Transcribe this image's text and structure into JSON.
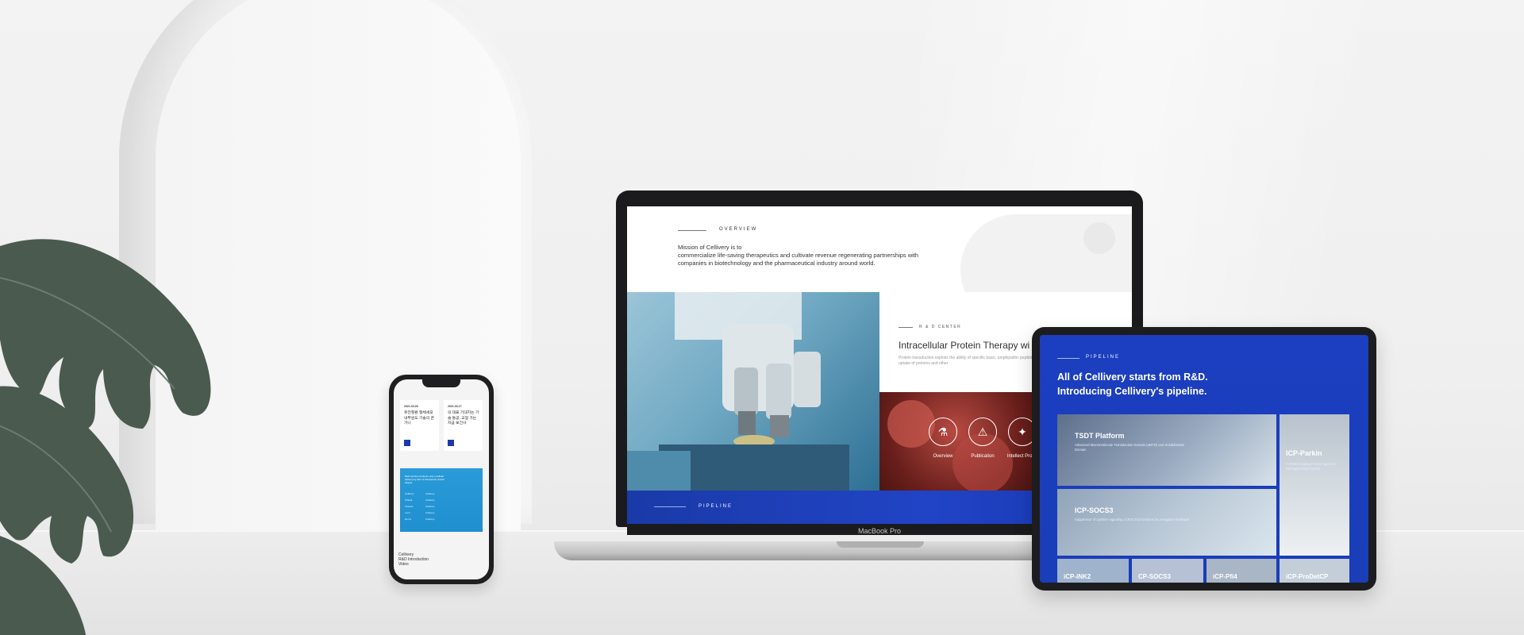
{
  "laptop": {
    "brand": "MacBook Pro",
    "overview": {
      "label": "OVERVIEW",
      "mission_line1": "Mission of Cellivery is to",
      "mission_line2": "commercialize life-saving therapeutics and cultivate revenue regenerating partnerships with",
      "mission_line3": "companies in biotechnology and the pharmaceutical industry around world."
    },
    "rd": {
      "label": "R & D CENTER",
      "title": "Intracellular Protein Therapy wi",
      "description": "Protein transduction exploits the ability of specific basic, amphipathic peptide (CPP) sequences to enhance the uptake of proteins and other",
      "icons": [
        {
          "label": "Overview",
          "glyph": "⚗"
        },
        {
          "label": "Publication",
          "glyph": "⚠"
        },
        {
          "label": "Intellect Propri",
          "glyph": "✦"
        }
      ]
    },
    "pipeline": {
      "label": "PIPELINE"
    }
  },
  "tablet": {
    "label": "PIPELINE",
    "heading_line1": "All of Cellivery starts from R&D.",
    "heading_line2": "Introducing Cellivery's pipeline.",
    "cards": [
      {
        "title": "TSDT Platform",
        "desc": "Advanced Macromolecule Transduction Domain (aMTD) and Solubilization Domain"
      },
      {
        "title": "ICP-Parkin",
        "desc": "A PINK1-binding Protein Agent for Damaged Mitochondria"
      },
      {
        "title": "ICP-SOCS3",
        "desc": "Suppressor of cytokine signaling 3 (SOCS3) functions as a negative feedback"
      }
    ],
    "bottom_cards": [
      "iCP-iNK2",
      "CP-SOCS3",
      "iCP-Pfi4",
      "iCP-ProDetCP"
    ]
  },
  "phone": {
    "cards": [
      {
        "date": "2021.03.28",
        "text": "유전질환 형체세포 내부원도 기술의 큰 가니"
      },
      {
        "date": "2021.03.17",
        "text": "의 대표 기대치는 기술 통공, 교정 가는 지급 보건사"
      }
    ],
    "blue_title": "Bold cell line produces only a cellular delivery by dent of therapeutic protein targets.",
    "rows": [
      {
        "label": "Cellivery",
        "value": "Cellivery"
      },
      {
        "label": "Phatidr",
        "value": "Cellivery"
      },
      {
        "label": "Vessels",
        "value": "Cellivery"
      },
      {
        "label": "Lumi",
        "value": "Cellivery"
      },
      {
        "label": "Dermi",
        "value": "Cellivery"
      }
    ],
    "bottom_line1": "Cellivery",
    "bottom_line2": "R&D Introduction",
    "bottom_line3": "Video"
  }
}
